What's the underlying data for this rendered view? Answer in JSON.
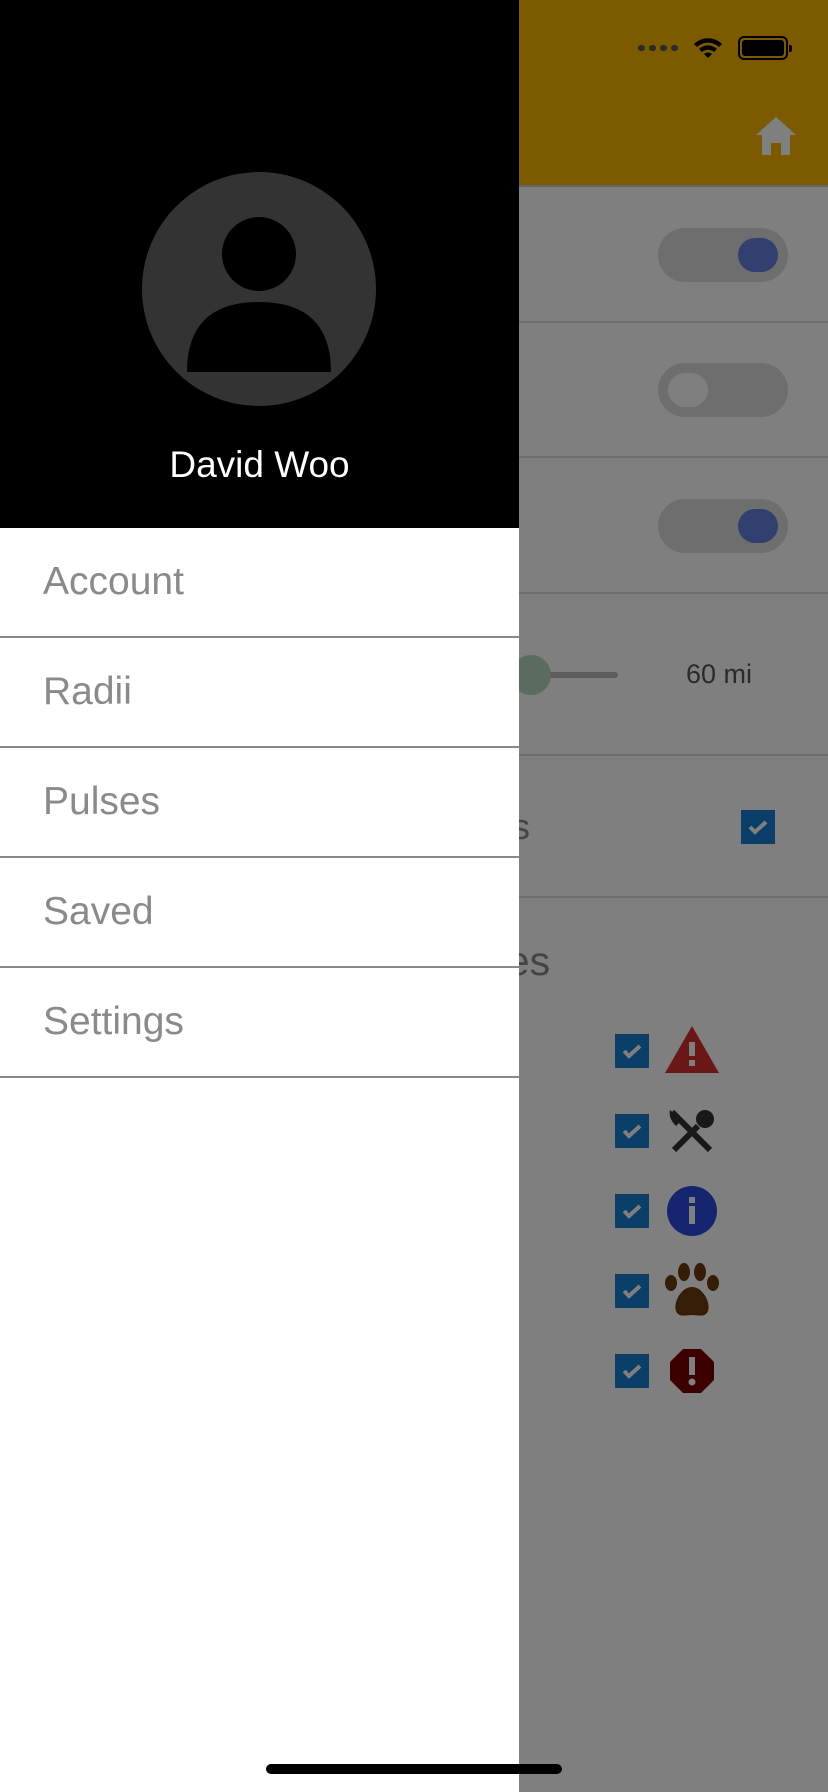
{
  "status_bar": {
    "icons": [
      "signal-icon",
      "wifi-icon",
      "battery-icon"
    ]
  },
  "background_app": {
    "header_icon": "home-icon",
    "toggles": [
      {
        "on": true
      },
      {
        "on": false
      },
      {
        "on": true
      }
    ],
    "slider": {
      "value_label": "60 mi"
    },
    "partial_label_1": "es",
    "partial_label_1_checked": true,
    "partial_heading": "ries",
    "categories": [
      {
        "icon": "warning-triangle-icon",
        "checked": true,
        "color": "#d32f2f"
      },
      {
        "icon": "utensils-icon",
        "checked": true,
        "color": "#333333"
      },
      {
        "icon": "info-icon",
        "checked": true,
        "color": "#2a4ae0"
      },
      {
        "icon": "paw-icon",
        "checked": true,
        "color": "#6b3a10"
      },
      {
        "icon": "alert-octagon-icon",
        "checked": true,
        "color": "#7a0000"
      }
    ],
    "accent": "#f6b400"
  },
  "drawer": {
    "user_name": "David Woo",
    "items": [
      {
        "label": "Account"
      },
      {
        "label": "Radii"
      },
      {
        "label": "Pulses"
      },
      {
        "label": "Saved"
      },
      {
        "label": "Settings"
      }
    ]
  }
}
